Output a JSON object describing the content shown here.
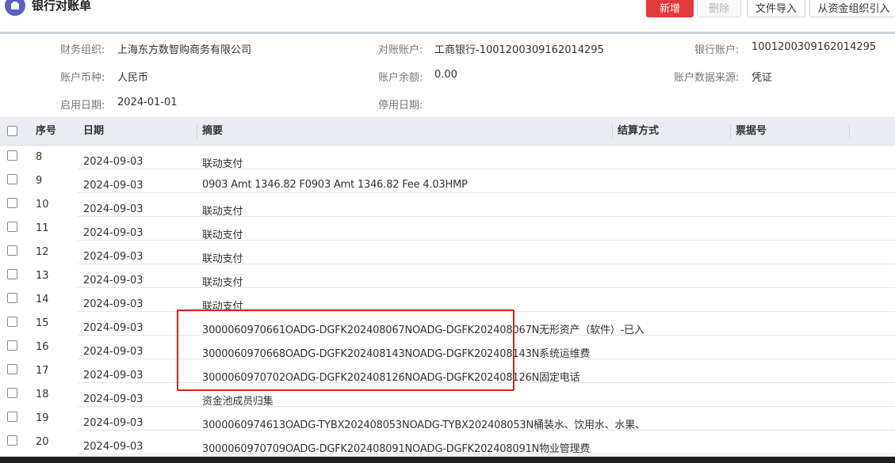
{
  "header": {
    "title": "银行对账单",
    "buttons": {
      "add": "新增",
      "delete": "删除",
      "file_import": "文件导入",
      "from_fund_org": "从资金组织引入"
    }
  },
  "form": {
    "org_label": "财务组织:",
    "org_value": "上海东方数智购商务有限公司",
    "account_label": "对账账户:",
    "account_value": "工商银行-1001200309162014295",
    "bank_account_label": "银行账户:",
    "bank_account_value": "1001200309162014295",
    "currency_label": "账户币种:",
    "currency_value": "人民币",
    "balance_label": "账户余额:",
    "balance_value": "0.00",
    "source_label": "账户数据来源:",
    "source_value": "凭证",
    "start_label": "启用日期:",
    "start_value": "2024-01-01",
    "stop_label": "停用日期:",
    "stop_value": ""
  },
  "table": {
    "columns": {
      "seq": "序号",
      "date": "日期",
      "summary": "摘要",
      "settlement": "结算方式",
      "bill_no": "票据号"
    },
    "rows": [
      {
        "seq": "8",
        "date": "2024-09-03",
        "summary": "联动支付"
      },
      {
        "seq": "9",
        "date": "2024-09-03",
        "summary": "0903 Amt 1346.82 F0903 Amt 1346.82 Fee 4.03HMP"
      },
      {
        "seq": "10",
        "date": "2024-09-03",
        "summary": "联动支付"
      },
      {
        "seq": "11",
        "date": "2024-09-03",
        "summary": "联动支付"
      },
      {
        "seq": "12",
        "date": "2024-09-03",
        "summary": "联动支付"
      },
      {
        "seq": "13",
        "date": "2024-09-03",
        "summary": "联动支付"
      },
      {
        "seq": "14",
        "date": "2024-09-03",
        "summary": "联动支付"
      },
      {
        "seq": "15",
        "date": "2024-09-03",
        "summary": "3000060970661OADG-DGFK202408067NOADG-DGFK202408067N无形资产（软件）-已入"
      },
      {
        "seq": "16",
        "date": "2024-09-03",
        "summary": "3000060970668OADG-DGFK202408143NOADG-DGFK202408143N系统运维费"
      },
      {
        "seq": "17",
        "date": "2024-09-03",
        "summary": "3000060970702OADG-DGFK202408126NOADG-DGFK202408126N固定电话"
      },
      {
        "seq": "18",
        "date": "2024-09-03",
        "summary": "资金池成员归集"
      },
      {
        "seq": "19",
        "date": "2024-09-03",
        "summary": "3000060974613OADG-TYBX202408053NOADG-TYBX202408053N桶装水、饮用水、水果、"
      },
      {
        "seq": "20",
        "date": "2024-09-03",
        "summary": "3000060970709OADG-DGFK202408091NOADG-DGFK202408091N物业管理费"
      }
    ]
  },
  "colors": {
    "primary": "#e4393c",
    "highlight": "#e02020",
    "header_bg": "#eaedf2"
  }
}
